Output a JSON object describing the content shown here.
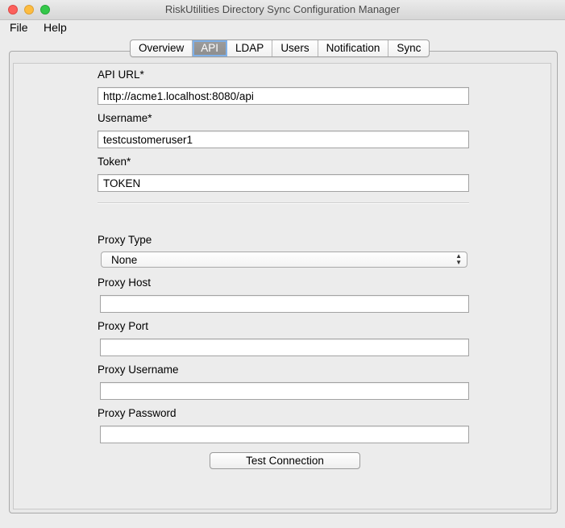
{
  "window": {
    "title": "RiskUtilities Directory Sync Configuration Manager"
  },
  "menu": {
    "items": [
      "File",
      "Help"
    ]
  },
  "tabs": {
    "items": [
      "Overview",
      "API",
      "LDAP",
      "Users",
      "Notification",
      "Sync"
    ],
    "active": "API"
  },
  "form": {
    "api_url": {
      "label": "API URL*",
      "value": "http://acme1.localhost:8080/api"
    },
    "username": {
      "label": "Username*",
      "value": "testcustomeruser1"
    },
    "token": {
      "label": "Token*",
      "value": "TOKEN"
    },
    "proxy_type": {
      "label": "Proxy Type",
      "value": "None"
    },
    "proxy_host": {
      "label": "Proxy Host",
      "value": ""
    },
    "proxy_port": {
      "label": "Proxy Port",
      "value": ""
    },
    "proxy_username": {
      "label": "Proxy Username",
      "value": ""
    },
    "proxy_password": {
      "label": "Proxy Password",
      "value": ""
    }
  },
  "actions": {
    "test_connection": "Test Connection"
  },
  "icons": {
    "close": "close-icon",
    "minimize": "minimize-icon",
    "maximize": "maximize-icon",
    "select_arrows": "updown-arrows-icon"
  },
  "colors": {
    "close": "#fc605c",
    "minimize": "#fdbc40",
    "maximize": "#34c84a",
    "active_tab": "#8d8d8d",
    "focus_ring": "#7fb0e8"
  }
}
